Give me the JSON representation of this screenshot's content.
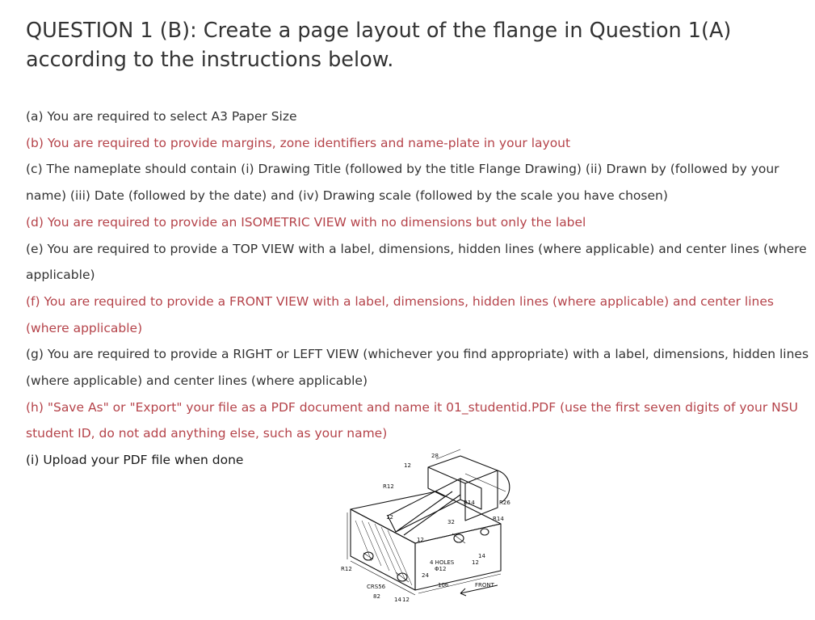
{
  "question": {
    "title": "QUESTION 1 (B): Create a page layout of the flange in Question 1(A) according to the instructions below."
  },
  "instructions": [
    {
      "text": "(a) You are required to select A3 Paper Size",
      "color": "#333333"
    },
    {
      "text": "(b) You are required to provide margins, zone identifiers and name-plate in your layout",
      "color": "#b5434a"
    },
    {
      "text": "(c) The nameplate should contain (i) Drawing Title (followed by the title Flange Drawing) (ii) Drawn by (followed by your name) (iii) Date (followed by the date) and (iv) Drawing scale (followed by the scale you have chosen)",
      "color": "#333333"
    },
    {
      "text": "(d) You are required to provide an ISOMETRIC VIEW with no dimensions but only the label",
      "color": "#b5434a"
    },
    {
      "text": "(e) You are required to provide a TOP VIEW with a label, dimensions, hidden lines (where applicable) and center lines (where applicable)",
      "color": "#333333"
    },
    {
      "text": "(f) You are required to provide a FRONT VIEW with a label, dimensions, hidden lines (where applicable) and center lines (where applicable)",
      "color": "#b5434a"
    },
    {
      "text": "(g) You are required to provide a RIGHT or LEFT VIEW (whichever you find appropriate) with a label, dimensions, hidden lines (where applicable) and center lines (where applicable)",
      "color": "#333333"
    },
    {
      "text": "(h) \"Save As\" or \"Export\" your file as a PDF document and name it 01_studentid.PDF (use the first seven digits of your NSU student ID, do not add anything else, such as your name)",
      "color": "#b5434a"
    },
    {
      "text": "(i) Upload your PDF file when done",
      "color": "#1a1a1a"
    }
  ],
  "drawing": {
    "labels": {
      "d28": "28",
      "d12_top": "12",
      "r12_top": "R12",
      "r14_right": "R14",
      "r26": "R26",
      "r14_b": "R14",
      "d12_left": "12",
      "d32": "32",
      "d12_mid": "12",
      "d14": "14",
      "holes": "4 HOLES",
      "phi12": "Φ12",
      "d12_right": "12",
      "d24": "24",
      "r12_left": "R12",
      "crs": "CRS56",
      "d106": "106",
      "front": "FRONT",
      "d82": "82",
      "d14b": "14",
      "d12b": "12"
    }
  }
}
